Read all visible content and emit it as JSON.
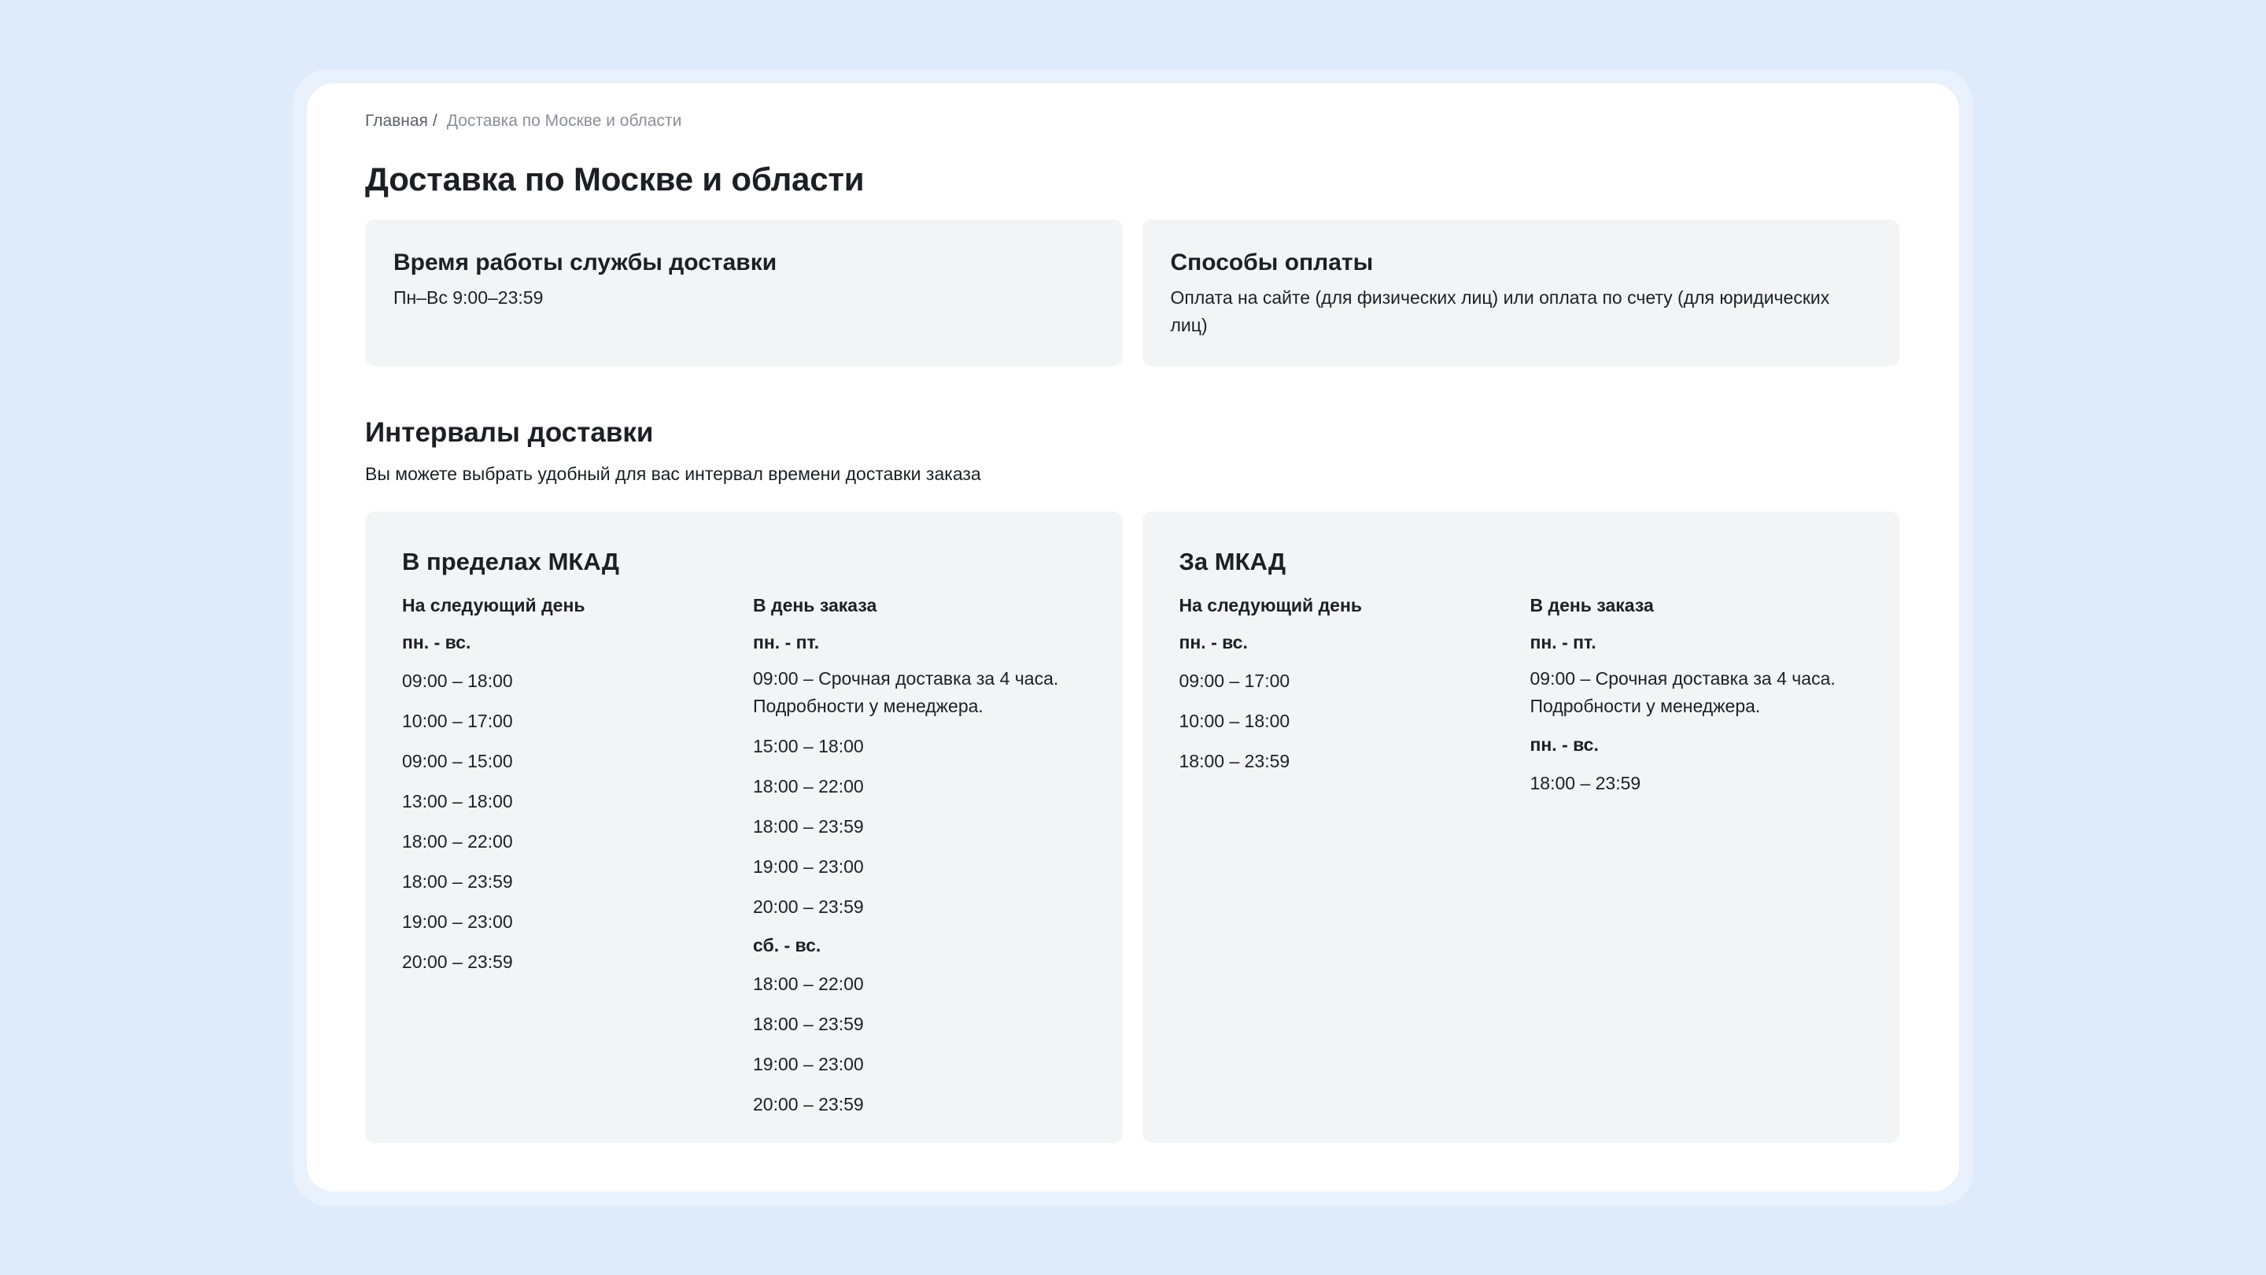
{
  "breadcrumb": {
    "home": "Главная",
    "separator": "/",
    "current": "Доставка по Москве и области"
  },
  "page_title": "Доставка по Москве и области",
  "info_cards": {
    "hours": {
      "title": "Время работы службы доставки",
      "text": "Пн–Вс 9:00–23:59"
    },
    "payment": {
      "title": "Способы оплаты",
      "text": "Оплата на сайте (для физических лиц) или оплата по счету (для юридических лиц)"
    }
  },
  "intervals": {
    "title": "Интервалы доставки",
    "intro": "Вы можете выбрать удобный для вас интервал времени доставки заказа",
    "inside": {
      "title": "В пределах МКАД",
      "next_day": {
        "title": "На следующий день",
        "days": "пн. - вс.",
        "slots": [
          "09:00 – 18:00",
          "10:00 – 17:00",
          "09:00 – 15:00",
          "13:00 – 18:00",
          "18:00 – 22:00",
          "18:00 – 23:59",
          "19:00 – 23:00",
          "20:00 – 23:59"
        ]
      },
      "same_day": {
        "title": "В день заказа",
        "weekdays": "пн. - пт.",
        "weekday_slots": [
          "09:00 – Срочная доставка за 4 часа. Подробности у менеджера.",
          "15:00 – 18:00",
          "18:00 – 22:00",
          "18:00 – 23:59",
          "19:00 – 23:00",
          "20:00 – 23:59"
        ],
        "weekend": "сб. - вс.",
        "weekend_slots": [
          "18:00 – 22:00",
          "18:00 – 23:59",
          "19:00 – 23:00",
          "20:00 – 23:59"
        ]
      }
    },
    "outside": {
      "title": "За МКАД",
      "next_day": {
        "title": "На следующий день",
        "days": "пн. - вс.",
        "slots": [
          "09:00 – 17:00",
          "10:00 – 18:00",
          "18:00 – 23:59"
        ]
      },
      "same_day": {
        "title": "В день заказа",
        "weekdays": "пн. - пт.",
        "weekday_slots": [
          "09:00 – Срочная доставка за 4 часа. Подробности у менеджера."
        ],
        "all_week": "пн. - вс.",
        "all_week_slots": [
          "18:00 – 23:59"
        ]
      }
    }
  }
}
